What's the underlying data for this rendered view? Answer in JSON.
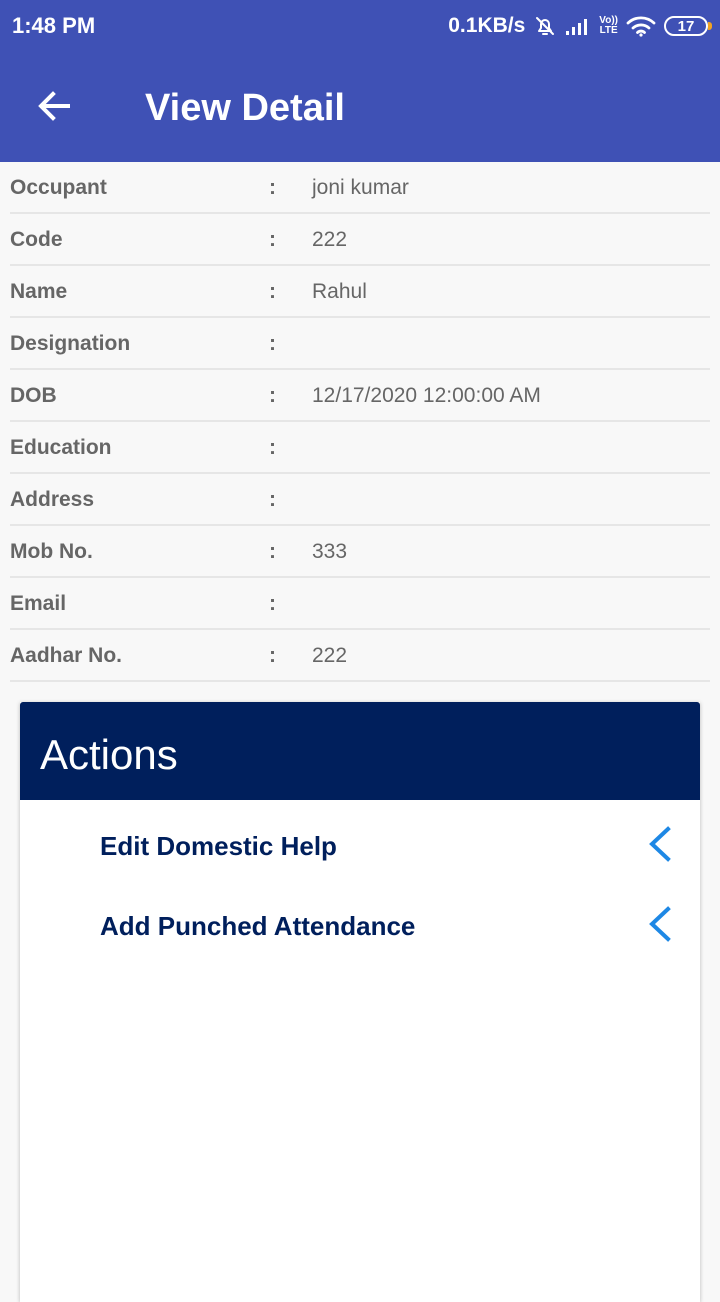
{
  "status_bar": {
    "time": "1:48 PM",
    "network_speed": "0.1KB/s",
    "volte_top": "Vo))",
    "volte_bottom": "LTE",
    "battery_level": "17",
    "icons": [
      "alarm-off-icon",
      "signal-icon",
      "wifi-icon",
      "battery-icon"
    ]
  },
  "header": {
    "title": "View Detail",
    "back_icon": "arrow-left-icon"
  },
  "details": [
    {
      "label": "Occupant",
      "colon": ":",
      "value": "joni kumar"
    },
    {
      "label": "Code",
      "colon": ":",
      "value": "222"
    },
    {
      "label": "Name",
      "colon": ":",
      "value": "Rahul"
    },
    {
      "label": "Designation",
      "colon": ":",
      "value": ""
    },
    {
      "label": "DOB",
      "colon": ":",
      "value": "12/17/2020 12:00:00 AM"
    },
    {
      "label": "Education",
      "colon": ":",
      "value": ""
    },
    {
      "label": "Address",
      "colon": ":",
      "value": ""
    },
    {
      "label": "Mob No.",
      "colon": ":",
      "value": "333"
    },
    {
      "label": "Email",
      "colon": ":",
      "value": ""
    },
    {
      "label": "Aadhar No.",
      "colon": ":",
      "value": "222"
    }
  ],
  "actions": {
    "title": "Actions",
    "items": [
      {
        "label": "Edit Domestic Help",
        "icon": "chevron-left-icon"
      },
      {
        "label": "Add Punched Attendance",
        "icon": "chevron-left-icon"
      }
    ]
  },
  "colors": {
    "app_bar": "#3f51b5",
    "actions_header": "#001f5c",
    "action_text": "#001f5c",
    "chevron": "#1e88e5",
    "detail_text": "#666666",
    "background": "#f8f8f8"
  }
}
